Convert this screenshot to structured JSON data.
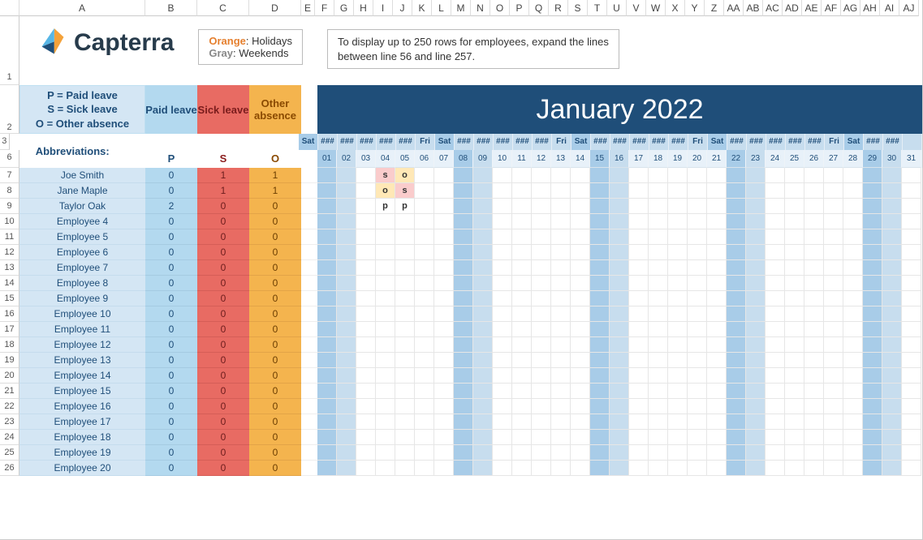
{
  "cols_main": [
    "A",
    "B",
    "C",
    "D"
  ],
  "cols_narrow": [
    "E"
  ],
  "cols_days": [
    "F",
    "G",
    "H",
    "I",
    "J",
    "K",
    "L",
    "M",
    "N",
    "O",
    "P",
    "Q",
    "R",
    "S",
    "T",
    "U",
    "V",
    "W",
    "X",
    "Y",
    "Z",
    "AA",
    "AB",
    "AC",
    "AD",
    "AE",
    "AF",
    "AG",
    "AH",
    "AI",
    "AJ"
  ],
  "brand": "Capterra",
  "legend": {
    "orange_label": "Orange",
    "orange_text": ": Holidays",
    "gray_label": "Gray",
    "gray_text": ": Weekends"
  },
  "note": "To display up to 250 rows for employees, expand the lines between line 56 and line 257.",
  "headers": {
    "def1": "P = Paid leave",
    "def2": "S = Sick leave",
    "def3": "O = Other absence",
    "paid": "Paid leave",
    "sick": "Sick leave",
    "other": "Other absence",
    "title": "January 2022",
    "abbrev_label": "Abbreviations:",
    "abbr_p": "P",
    "abbr_s": "S",
    "abbr_o": "O"
  },
  "days": [
    {
      "n": "01",
      "w": "Sat",
      "kind": "sat"
    },
    {
      "n": "02",
      "w": "###",
      "kind": "weekend"
    },
    {
      "n": "03",
      "w": "###",
      "kind": ""
    },
    {
      "n": "04",
      "w": "###",
      "kind": ""
    },
    {
      "n": "05",
      "w": "###",
      "kind": ""
    },
    {
      "n": "06",
      "w": "###",
      "kind": ""
    },
    {
      "n": "07",
      "w": "Fri",
      "kind": ""
    },
    {
      "n": "08",
      "w": "Sat",
      "kind": "sat"
    },
    {
      "n": "09",
      "w": "###",
      "kind": "weekend"
    },
    {
      "n": "10",
      "w": "###",
      "kind": ""
    },
    {
      "n": "11",
      "w": "###",
      "kind": ""
    },
    {
      "n": "12",
      "w": "###",
      "kind": ""
    },
    {
      "n": "13",
      "w": "###",
      "kind": ""
    },
    {
      "n": "14",
      "w": "Fri",
      "kind": ""
    },
    {
      "n": "15",
      "w": "Sat",
      "kind": "sat"
    },
    {
      "n": "16",
      "w": "###",
      "kind": "weekend"
    },
    {
      "n": "17",
      "w": "###",
      "kind": ""
    },
    {
      "n": "18",
      "w": "###",
      "kind": ""
    },
    {
      "n": "19",
      "w": "###",
      "kind": ""
    },
    {
      "n": "20",
      "w": "###",
      "kind": ""
    },
    {
      "n": "21",
      "w": "Fri",
      "kind": ""
    },
    {
      "n": "22",
      "w": "Sat",
      "kind": "sat"
    },
    {
      "n": "23",
      "w": "###",
      "kind": "weekend"
    },
    {
      "n": "24",
      "w": "###",
      "kind": ""
    },
    {
      "n": "25",
      "w": "###",
      "kind": ""
    },
    {
      "n": "26",
      "w": "###",
      "kind": ""
    },
    {
      "n": "27",
      "w": "###",
      "kind": ""
    },
    {
      "n": "28",
      "w": "Fri",
      "kind": ""
    },
    {
      "n": "29",
      "w": "Sat",
      "kind": "sat"
    },
    {
      "n": "30",
      "w": "###",
      "kind": "weekend"
    },
    {
      "n": "31",
      "w": "###",
      "kind": ""
    }
  ],
  "rownums": {
    "r1": "1",
    "r2": "2",
    "r3": "3",
    "r6": "6",
    "data": [
      "7",
      "8",
      "9",
      "10",
      "11",
      "12",
      "13",
      "14",
      "15",
      "16",
      "17",
      "18",
      "19",
      "20",
      "21",
      "22",
      "23",
      "24",
      "25",
      "26"
    ]
  },
  "employees": [
    {
      "name": "Joe Smith",
      "paid": 0,
      "sick": 1,
      "other": 1,
      "marks": {
        "4": "s",
        "5": "o"
      }
    },
    {
      "name": "Jane Maple",
      "paid": 0,
      "sick": 1,
      "other": 1,
      "marks": {
        "4": "o",
        "5": "s"
      }
    },
    {
      "name": "Taylor Oak",
      "paid": 2,
      "sick": 0,
      "other": 0,
      "marks": {
        "4": "p",
        "5": "p"
      }
    },
    {
      "name": "Employee 4",
      "paid": 0,
      "sick": 0,
      "other": 0,
      "marks": {}
    },
    {
      "name": "Employee 5",
      "paid": 0,
      "sick": 0,
      "other": 0,
      "marks": {}
    },
    {
      "name": "Employee 6",
      "paid": 0,
      "sick": 0,
      "other": 0,
      "marks": {}
    },
    {
      "name": "Employee 7",
      "paid": 0,
      "sick": 0,
      "other": 0,
      "marks": {}
    },
    {
      "name": "Employee 8",
      "paid": 0,
      "sick": 0,
      "other": 0,
      "marks": {}
    },
    {
      "name": "Employee 9",
      "paid": 0,
      "sick": 0,
      "other": 0,
      "marks": {}
    },
    {
      "name": "Employee 10",
      "paid": 0,
      "sick": 0,
      "other": 0,
      "marks": {}
    },
    {
      "name": "Employee 11",
      "paid": 0,
      "sick": 0,
      "other": 0,
      "marks": {}
    },
    {
      "name": "Employee 12",
      "paid": 0,
      "sick": 0,
      "other": 0,
      "marks": {}
    },
    {
      "name": "Employee 13",
      "paid": 0,
      "sick": 0,
      "other": 0,
      "marks": {}
    },
    {
      "name": "Employee 14",
      "paid": 0,
      "sick": 0,
      "other": 0,
      "marks": {}
    },
    {
      "name": "Employee 15",
      "paid": 0,
      "sick": 0,
      "other": 0,
      "marks": {}
    },
    {
      "name": "Employee 16",
      "paid": 0,
      "sick": 0,
      "other": 0,
      "marks": {}
    },
    {
      "name": "Employee 17",
      "paid": 0,
      "sick": 0,
      "other": 0,
      "marks": {}
    },
    {
      "name": "Employee 18",
      "paid": 0,
      "sick": 0,
      "other": 0,
      "marks": {}
    },
    {
      "name": "Employee 19",
      "paid": 0,
      "sick": 0,
      "other": 0,
      "marks": {}
    },
    {
      "name": "Employee 20",
      "paid": 0,
      "sick": 0,
      "other": 0,
      "marks": {}
    }
  ]
}
